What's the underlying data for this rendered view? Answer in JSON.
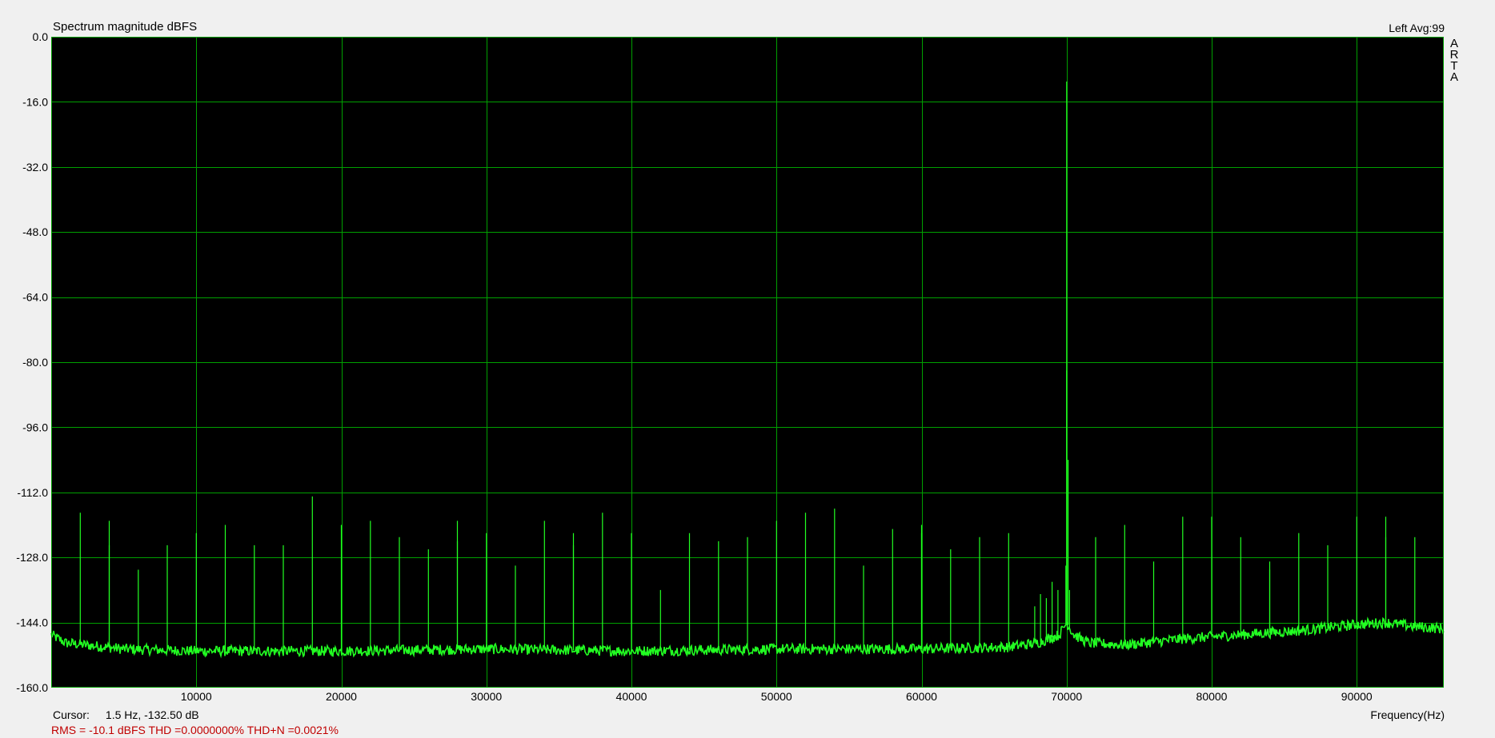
{
  "header": {
    "title": "Spectrum magnitude dBFS",
    "status": "Left  Avg:99",
    "brand": "ARTA"
  },
  "footer": {
    "cursor_label": "Cursor:",
    "cursor_value": "1.5 Hz, -132.50 dB",
    "stats": "RMS =  -10.1 dBFS   THD =0.0000000%   THD+N =0.0021%",
    "xlabel": "Frequency(Hz)"
  },
  "colors": {
    "background": "#000000",
    "grid": "#00a000",
    "trace": "#22ff22",
    "border": "#00a000"
  },
  "chart_data": {
    "type": "line",
    "title": "Spectrum magnitude dBFS",
    "xlabel": "Frequency(Hz)",
    "ylabel": "",
    "xlim": [
      0,
      96000
    ],
    "ylim": [
      -160,
      0
    ],
    "grid": true,
    "yticks": [
      0,
      -16,
      -32,
      -48,
      -64,
      -80,
      -96,
      -112,
      -128,
      -144,
      -160
    ],
    "ytick_labels": [
      "0.0",
      "-16.0",
      "-32.0",
      "-48.0",
      "-64.0",
      "-80.0",
      "-96.0",
      "-112.0",
      "-128.0",
      "-144.0",
      "-160.0"
    ],
    "xticks": [
      10000,
      20000,
      30000,
      40000,
      50000,
      60000,
      70000,
      80000,
      90000
    ],
    "xtick_labels": [
      "10000",
      "20000",
      "30000",
      "40000",
      "50000",
      "60000",
      "70000",
      "80000",
      "90000"
    ],
    "noise_floor": [
      [
        0,
        -147
      ],
      [
        1000,
        -149
      ],
      [
        5000,
        -150.5
      ],
      [
        10000,
        -151
      ],
      [
        15000,
        -151
      ],
      [
        20000,
        -151
      ],
      [
        30000,
        -150.5
      ],
      [
        40000,
        -151
      ],
      [
        50000,
        -150.5
      ],
      [
        60000,
        -150.5
      ],
      [
        66000,
        -150
      ],
      [
        68000,
        -149
      ],
      [
        69500,
        -147
      ],
      [
        70000,
        -144
      ],
      [
        70500,
        -147
      ],
      [
        71500,
        -149
      ],
      [
        74000,
        -149.5
      ],
      [
        78000,
        -148
      ],
      [
        82000,
        -147
      ],
      [
        86000,
        -146
      ],
      [
        90000,
        -144.5
      ],
      [
        92000,
        -144
      ],
      [
        94000,
        -145
      ],
      [
        96000,
        -145.5
      ]
    ],
    "peaks": [
      [
        70000,
        -11
      ],
      [
        70000,
        -82
      ],
      [
        70100,
        -104
      ],
      [
        69950,
        -130
      ],
      [
        70200,
        -136
      ],
      [
        2000,
        -117
      ],
      [
        4000,
        -119
      ],
      [
        4000,
        -125
      ],
      [
        6000,
        -131
      ],
      [
        8000,
        -125
      ],
      [
        10000,
        -122
      ],
      [
        12000,
        -120
      ],
      [
        14000,
        -125
      ],
      [
        16000,
        -125
      ],
      [
        18000,
        -113
      ],
      [
        20000,
        -120
      ],
      [
        22000,
        -119
      ],
      [
        24000,
        -123
      ],
      [
        26000,
        -126
      ],
      [
        28000,
        -119
      ],
      [
        28000,
        -124
      ],
      [
        30000,
        -122
      ],
      [
        32000,
        -130
      ],
      [
        34000,
        -119
      ],
      [
        36000,
        -122
      ],
      [
        36000,
        -125
      ],
      [
        38000,
        -117
      ],
      [
        40000,
        -122
      ],
      [
        42000,
        -136
      ],
      [
        44000,
        -122
      ],
      [
        46000,
        -124
      ],
      [
        48000,
        -123
      ],
      [
        50000,
        -119
      ],
      [
        52000,
        -117
      ],
      [
        54000,
        -116
      ],
      [
        56000,
        -130
      ],
      [
        58000,
        -121
      ],
      [
        60000,
        -120
      ],
      [
        60000,
        -122
      ],
      [
        62000,
        -126
      ],
      [
        64000,
        -123
      ],
      [
        66000,
        -122
      ],
      [
        67800,
        -140
      ],
      [
        68200,
        -137
      ],
      [
        68600,
        -138
      ],
      [
        69000,
        -134
      ],
      [
        69400,
        -136
      ],
      [
        72000,
        -123
      ],
      [
        74000,
        -120
      ],
      [
        76000,
        -129
      ],
      [
        78000,
        -118
      ],
      [
        80000,
        -118
      ],
      [
        82000,
        -123
      ],
      [
        84000,
        -129
      ],
      [
        84000,
        -131
      ],
      [
        86000,
        -122
      ],
      [
        88000,
        -125
      ],
      [
        90000,
        -118
      ],
      [
        92000,
        -118
      ],
      [
        92000,
        -123
      ],
      [
        94000,
        -123
      ]
    ]
  }
}
